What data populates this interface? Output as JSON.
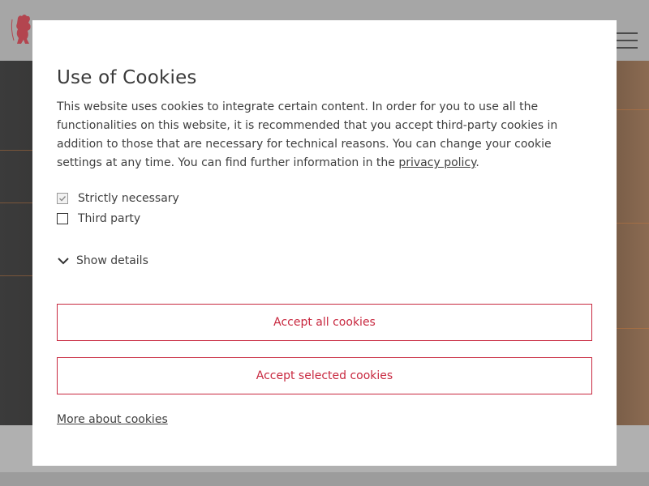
{
  "modal": {
    "title": "Use of Cookies",
    "text_before_link": "This website uses cookies to integrate certain content. In order for you to use all the functionalities on this website, it is recommended that you accept third-party cookies in addition to those that are necessary for technical reasons. You can change your cookie settings at any time. You can find further information in the ",
    "link_text": "privacy policy",
    "text_after_link": ".",
    "options": [
      {
        "label": "Strictly necessary",
        "checked": true,
        "disabled": true
      },
      {
        "label": "Third party",
        "checked": false,
        "disabled": false
      }
    ],
    "show_details_label": "Show details",
    "accept_all_label": "Accept all cookies",
    "accept_selected_label": "Accept selected cookies",
    "more_link_label": "More about cookies"
  },
  "background": {
    "logo_icon": "bear-logo-icon",
    "menu_icon": "hamburger-menu-icon"
  },
  "colors": {
    "accent": "#c8283f",
    "text": "#3f3f3f",
    "header_bg": "#a6a6a6"
  }
}
